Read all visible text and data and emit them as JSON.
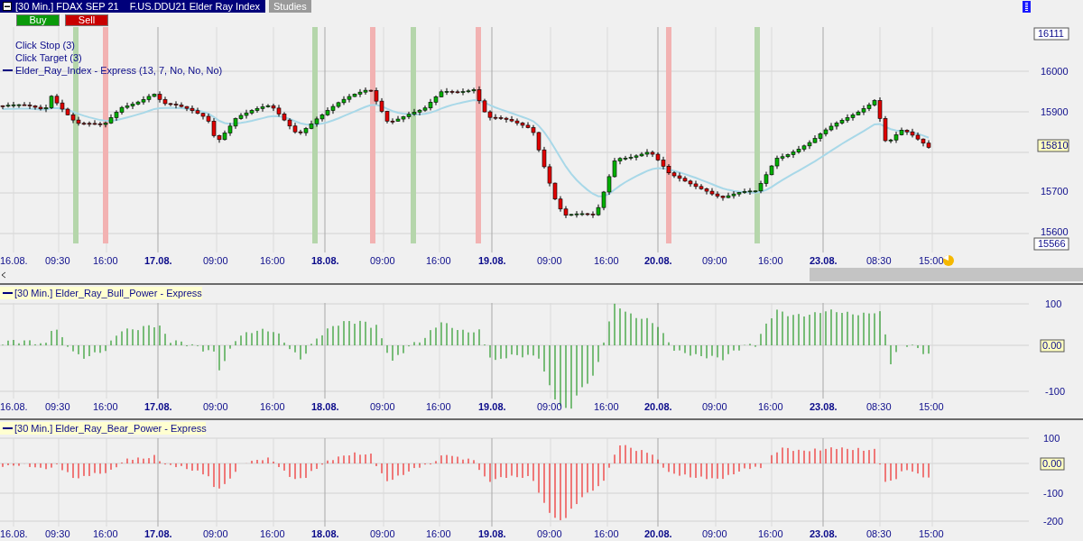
{
  "window": {
    "instrument": "[30 Min.] FDAX SEP 21",
    "title": "F.US.DDU21 Elder Ray Index"
  },
  "toolbar": {
    "studies_button": "Studies"
  },
  "order_buttons": [
    {
      "label": "Buy",
      "kind": "buy"
    },
    {
      "label": "Sell",
      "kind": "sell"
    }
  ],
  "price_panel": {
    "legend": [
      {
        "label": "Click Stop  (3)",
        "kind": "text"
      },
      {
        "label": "Click Target  (3)",
        "kind": "text"
      },
      {
        "label": "Elder_Ray_Index - Express  (13, 7, No, No, No)",
        "kind": "line"
      }
    ],
    "price_axis": [
      {
        "label": "16111",
        "kind": "high"
      },
      {
        "label": "16000",
        "kind": "tick"
      },
      {
        "label": "15900",
        "kind": "tick"
      },
      {
        "label": "15810",
        "kind": "last"
      },
      {
        "label": "15700",
        "kind": "tick"
      },
      {
        "label": "15600",
        "kind": "tick"
      },
      {
        "label": "15566",
        "kind": "low"
      }
    ],
    "time_axis": [
      {
        "label": "16.08.",
        "kind": "time"
      },
      {
        "label": "09:30",
        "kind": "time"
      },
      {
        "label": "16:00",
        "kind": "time"
      },
      {
        "label": "17.08.",
        "kind": "date"
      },
      {
        "label": "09:00",
        "kind": "time"
      },
      {
        "label": "16:00",
        "kind": "time"
      },
      {
        "label": "18.08.",
        "kind": "date"
      },
      {
        "label": "09:00",
        "kind": "time"
      },
      {
        "label": "16:00",
        "kind": "time"
      },
      {
        "label": "19.08.",
        "kind": "date"
      },
      {
        "label": "09:00",
        "kind": "time"
      },
      {
        "label": "16:00",
        "kind": "time"
      },
      {
        "label": "20.08.",
        "kind": "date"
      },
      {
        "label": "09:00",
        "kind": "time"
      },
      {
        "label": "16:00",
        "kind": "time"
      },
      {
        "label": "23.08.",
        "kind": "date"
      },
      {
        "label": "08:30",
        "kind": "time"
      },
      {
        "label": "15:00",
        "kind": "time"
      }
    ]
  },
  "bull_panel": {
    "legend": "[30 Min.] Elder_Ray_Bull_Power - Express",
    "value_axis": [
      {
        "label": "100",
        "kind": "tick"
      },
      {
        "label": "0.00",
        "kind": "last"
      },
      {
        "label": "-100",
        "kind": "tick"
      }
    ],
    "time_axis": [
      {
        "label": "16.08.",
        "kind": "time"
      },
      {
        "label": "09:30",
        "kind": "time"
      },
      {
        "label": "16:00",
        "kind": "time"
      },
      {
        "label": "17.08.",
        "kind": "date"
      },
      {
        "label": "09:00",
        "kind": "time"
      },
      {
        "label": "16:00",
        "kind": "time"
      },
      {
        "label": "18.08.",
        "kind": "date"
      },
      {
        "label": "09:00",
        "kind": "time"
      },
      {
        "label": "16:00",
        "kind": "time"
      },
      {
        "label": "19.08.",
        "kind": "date"
      },
      {
        "label": "09:00",
        "kind": "time"
      },
      {
        "label": "16:00",
        "kind": "time"
      },
      {
        "label": "20.08.",
        "kind": "date"
      },
      {
        "label": "09:00",
        "kind": "time"
      },
      {
        "label": "16:00",
        "kind": "time"
      },
      {
        "label": "23.08.",
        "kind": "date"
      },
      {
        "label": "08:30",
        "kind": "time"
      },
      {
        "label": "15:00",
        "kind": "time"
      }
    ]
  },
  "bear_panel": {
    "legend": "[30 Min.] Elder_Ray_Bear_Power - Express",
    "value_axis": [
      {
        "label": "100",
        "kind": "tick"
      },
      {
        "label": "0.00",
        "kind": "last"
      },
      {
        "label": "-100",
        "kind": "tick"
      },
      {
        "label": "-200",
        "kind": "tick"
      }
    ],
    "time_axis": [
      {
        "label": "16.08.",
        "kind": "time"
      },
      {
        "label": "09:30",
        "kind": "time"
      },
      {
        "label": "16:00",
        "kind": "time"
      },
      {
        "label": "17.08.",
        "kind": "date"
      },
      {
        "label": "09:00",
        "kind": "time"
      },
      {
        "label": "16:00",
        "kind": "time"
      },
      {
        "label": "18.08.",
        "kind": "date"
      },
      {
        "label": "09:00",
        "kind": "time"
      },
      {
        "label": "16:00",
        "kind": "time"
      },
      {
        "label": "19.08.",
        "kind": "date"
      },
      {
        "label": "09:00",
        "kind": "time"
      },
      {
        "label": "16:00",
        "kind": "time"
      },
      {
        "label": "20.08.",
        "kind": "date"
      },
      {
        "label": "09:00",
        "kind": "time"
      },
      {
        "label": "16:00",
        "kind": "time"
      },
      {
        "label": "23.08.",
        "kind": "date"
      },
      {
        "label": "08:30",
        "kind": "time"
      },
      {
        "label": "15:00",
        "kind": "time"
      }
    ]
  }
}
